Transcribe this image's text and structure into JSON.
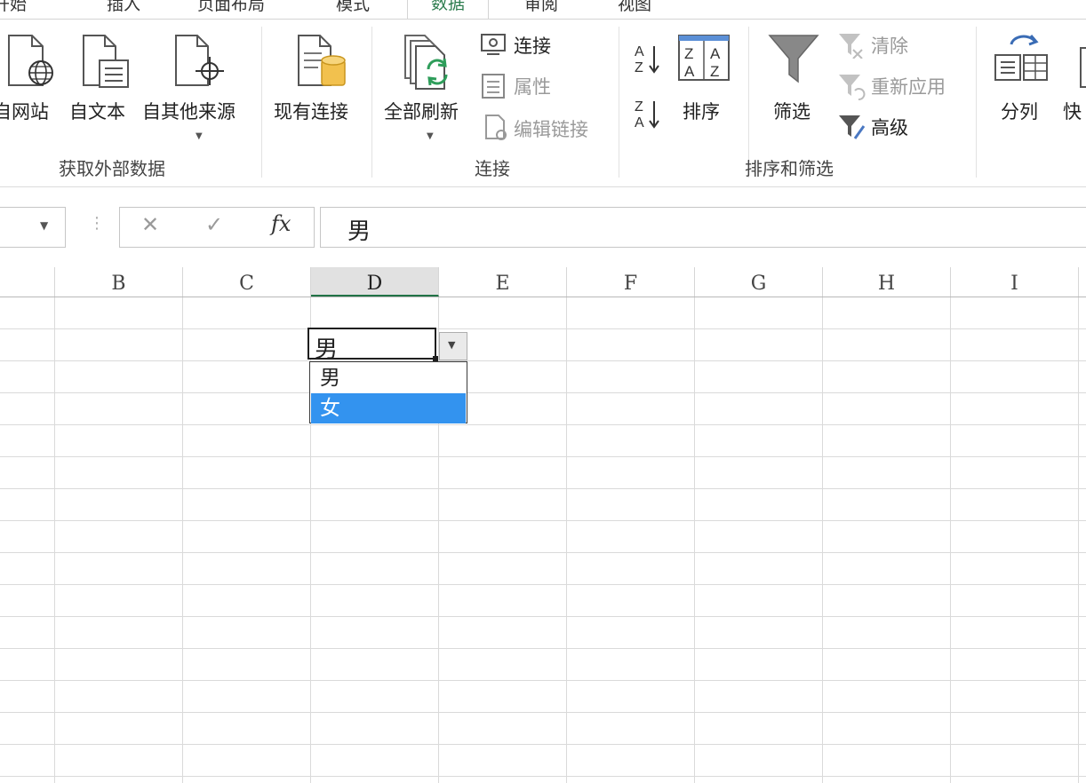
{
  "tabs": [
    {
      "label": "开始"
    },
    {
      "label": "插入"
    },
    {
      "label": "页面布局"
    },
    {
      "label": "模式"
    },
    {
      "label": "数据"
    },
    {
      "label": "审阅"
    },
    {
      "label": "视图"
    }
  ],
  "ribbon": {
    "get_external": {
      "from_web": "自网站",
      "from_text": "自文本",
      "from_other": "自其他来源",
      "group_label": "获取外部数据"
    },
    "existing": "现有连接",
    "connections": {
      "refresh_all": "全部刷新",
      "connections": "连接",
      "properties": "属性",
      "edit_links": "编辑链接",
      "group_label": "连接"
    },
    "sort_filter": {
      "sort": "排序",
      "filter": "筛选",
      "clear": "清除",
      "reapply": "重新应用",
      "advanced": "高级",
      "group_label": "排序和筛选"
    },
    "text_to_columns": "分列",
    "flash_fill": "快"
  },
  "formula_bar": {
    "cancel_glyph": "✕",
    "enter_glyph": "✓",
    "fx": "fx",
    "value": "男"
  },
  "columns": [
    "B",
    "C",
    "D",
    "E",
    "F",
    "G",
    "H",
    "I"
  ],
  "selected_column": "D",
  "active_cell": {
    "value": "男"
  },
  "dropdown": {
    "options": [
      "男",
      "女"
    ],
    "highlighted": "女"
  },
  "colors": {
    "accent": "#217346",
    "highlight": "#3393ef"
  }
}
